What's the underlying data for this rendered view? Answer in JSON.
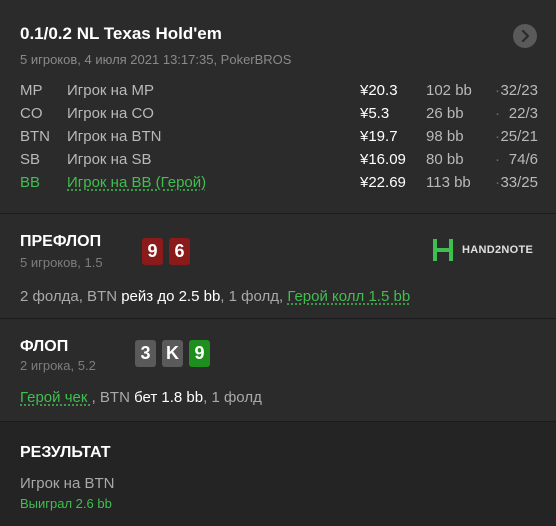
{
  "header": {
    "title": "0.1/0.2 NL Texas Hold'em",
    "subtitle": "5 игроков, 4 июля 2021 13:17:35, PokerBROS",
    "next_icon": "chevron-right-icon"
  },
  "players": [
    {
      "pos": "MP",
      "name": "Игрок на MP",
      "money": "¥20.3",
      "bb": "102 bb",
      "dot": "·",
      "stats": "32/23",
      "hero": false
    },
    {
      "pos": "CO",
      "name": "Игрок на CO",
      "money": "¥5.3",
      "bb": "26 bb",
      "dot": "·",
      "stats": "22/3",
      "hero": false
    },
    {
      "pos": "BTN",
      "name": "Игрок на BTN",
      "money": "¥19.7",
      "bb": "98 bb",
      "dot": "·",
      "stats": "25/21",
      "hero": false
    },
    {
      "pos": "SB",
      "name": "Игрок на SB",
      "money": "¥16.09",
      "bb": "80 bb",
      "dot": "·",
      "stats": "74/6",
      "hero": false
    },
    {
      "pos": "BB",
      "name": "Игрок на BB (Герой)",
      "money": "¥22.69",
      "bb": "113 bb",
      "dot": "·",
      "stats": "33/25",
      "hero": true
    }
  ],
  "preflop": {
    "title": "ПРЕФЛОП",
    "subtitle": "5 игроков, 1.5",
    "cards": [
      {
        "rank": "9",
        "color": "#8b1a1a"
      },
      {
        "rank": "6",
        "color": "#8b1a1a"
      }
    ],
    "action": {
      "p1": "2 фолда, BTN ",
      "raise": "рейз до 2.5 bb",
      "p2": ", 1 фолд, ",
      "hero": "Герой",
      "call": " колл 1.5 bb"
    }
  },
  "logo": {
    "text": "HAND2NOTE",
    "icon": "hand2note-logo-icon",
    "color": "#3fbf4f"
  },
  "flop": {
    "title": "ФЛОП",
    "subtitle": "2 игрока, 5.2",
    "cards": [
      {
        "rank": "3",
        "color": "#5a5a5a"
      },
      {
        "rank": "K",
        "color": "#5a5a5a"
      },
      {
        "rank": "9",
        "color": "#1e8f1e"
      }
    ],
    "action": {
      "hero_check": "Герой чек ",
      "p1": ", BTN ",
      "bet": "бет 1.8 bb",
      "p2": ", 1 фолд"
    }
  },
  "result": {
    "title": "РЕЗУЛЬТАТ",
    "player": "Игрок на BTN",
    "won": "Выиграл 2.6 bb"
  }
}
